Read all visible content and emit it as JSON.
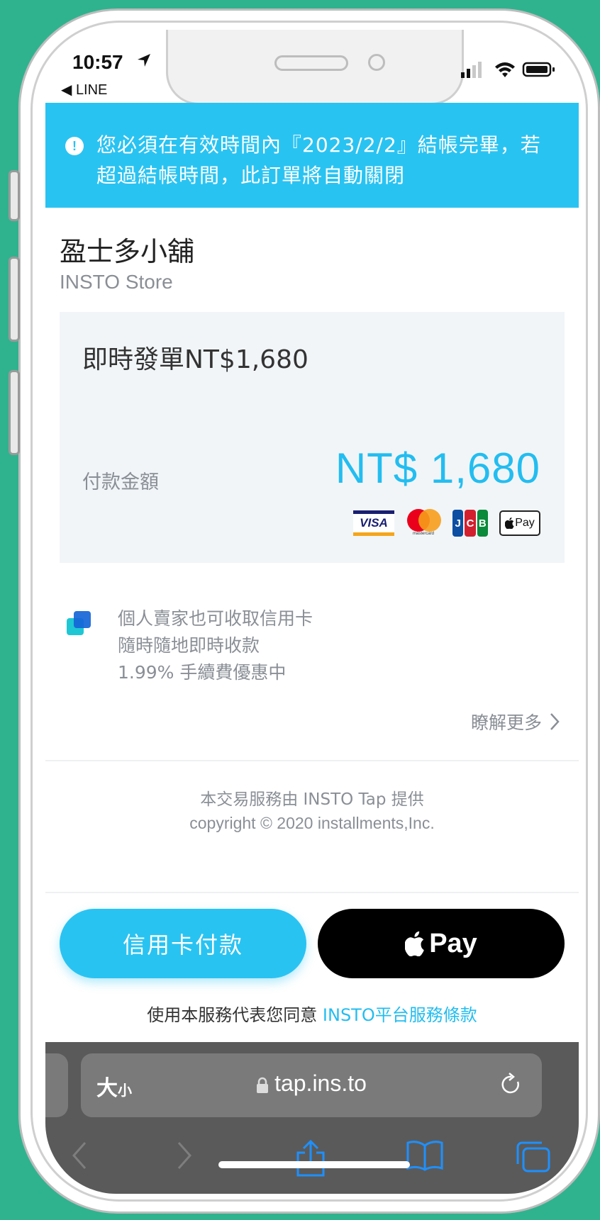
{
  "status_bar": {
    "time": "10:57",
    "back_app": "◀ LINE"
  },
  "banner": {
    "icon": "!",
    "text": "您必須在有效時間內『2023/2/2』結帳完畢，若超過結帳時間，此訂單將自動關閉"
  },
  "store": {
    "name": "盈士多小舖",
    "subtitle": "INSTO Store"
  },
  "order": {
    "title": "即時發單NT$1,680",
    "pay_label": "付款金額",
    "pay_amount": "NT$ 1,680",
    "card_logos": {
      "visa": "VISA",
      "mastercard": "mastercard",
      "jcb": "JCB",
      "applepay": "Pay"
    }
  },
  "promo": {
    "lines": [
      "個人賣家也可收取信用卡",
      "隨時隨地即時收款",
      "1.99% 手續費優惠中"
    ],
    "learn_more": "瞭解更多"
  },
  "footer": {
    "line1": "本交易服務由 INSTO Tap 提供",
    "line2": "copyright © 2020 installments,Inc."
  },
  "buttons": {
    "card_pay": "信用卡付款",
    "apple_pay": "Pay"
  },
  "terms": {
    "prefix": "使用本服務代表您同意 ",
    "link": "INSTO平台服務條款"
  },
  "safari": {
    "text_size_big": "大",
    "text_size_small": "小",
    "url": "tap.ins.to"
  },
  "colors": {
    "accent": "#29c3f2",
    "amount": "#23bdf0",
    "background": "#2fb38e"
  }
}
